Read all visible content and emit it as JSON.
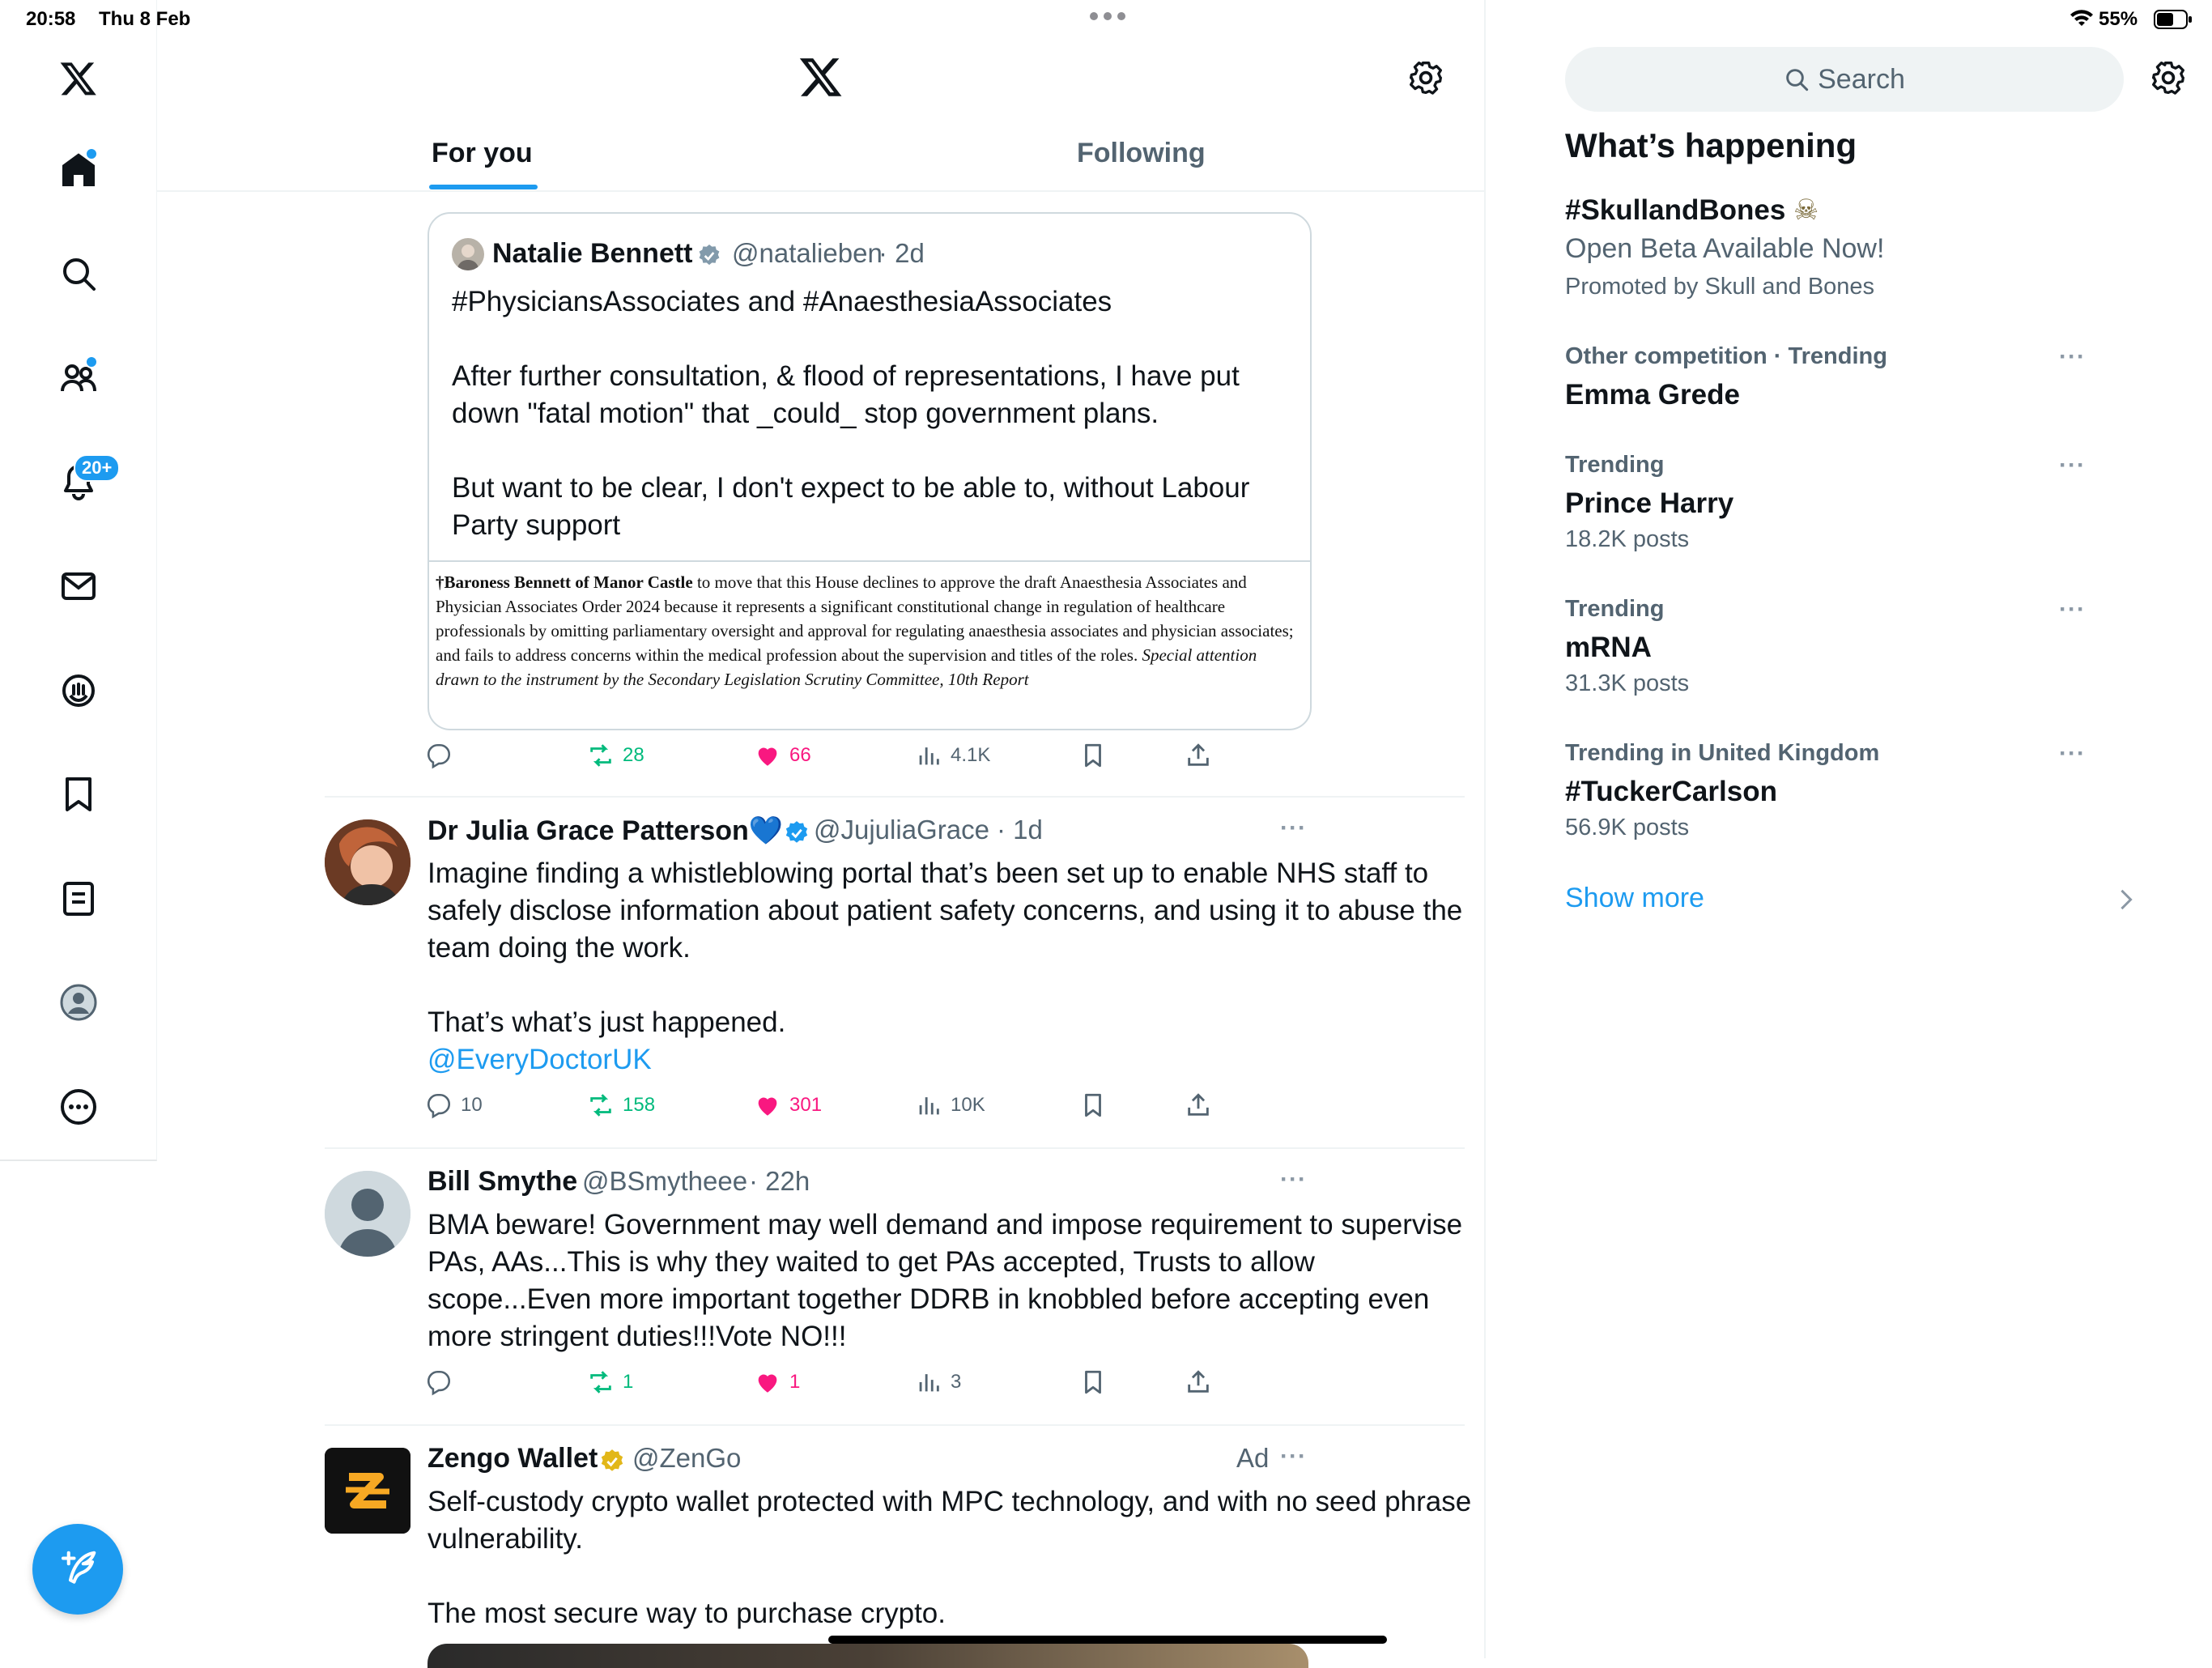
{
  "status_bar": {
    "time": "20:58",
    "date": "Thu 8 Feb",
    "battery": "55%"
  },
  "nav": {
    "notifications_badge": "20+",
    "items": [
      "home-icon",
      "search-icon",
      "communities-icon",
      "notifications-icon",
      "messages-icon",
      "grok-icon",
      "bookmarks-icon",
      "lists-icon",
      "profile-icon",
      "more-icon"
    ]
  },
  "header": {
    "tabs": [
      {
        "label": "For you",
        "active": true
      },
      {
        "label": "Following",
        "active": false
      }
    ]
  },
  "feed": {
    "quoted_tweet": {
      "name": "Natalie Bennett",
      "handle": "@natalieben",
      "time": "· 2d",
      "text": "#PhysiciansAssociates and #AnaesthesiaAssociates\n\nAfter further consultation, & flood of representations, I have put down \"fatal motion\" that _could_ stop government plans.\n\nBut want to be clear, I don't expect to be able to, without Labour Party support",
      "image_text_bold": "†Baroness Bennett of Manor Castle",
      "image_text": " to move that this House declines to approve the draft Anaesthesia Associates and Physician Associates Order 2024 because it represents a significant constitutional change in regulation of healthcare professionals by omitting parliamentary oversight and approval for regulating anaesthesia associates and physician associates; and fails to address concerns within the medical profession about the supervision and titles of the roles. ",
      "image_text_italic": "Special attention drawn to the instrument by the Secondary Legislation Scrutiny Committee, 10th Report",
      "actions": {
        "replies": "",
        "reposts": "28",
        "likes": "66",
        "views": "4.1K"
      }
    },
    "tweets": [
      {
        "name": "Dr Julia Grace Patterson💙",
        "handle": "@JujuliaGrace",
        "time": "· 1d",
        "text": "Imagine finding a whistleblowing portal that’s been set up to enable NHS staff to safely disclose information about patient safety concerns, and using it to abuse the team doing the work.\n\nThat’s what’s just happened.",
        "mention": "@EveryDoctorUK",
        "actions": {
          "replies": "10",
          "reposts": "158",
          "likes": "301",
          "views": "10K"
        }
      },
      {
        "name": "Bill Smythe",
        "handle": "@BSmytheee",
        "time": "· 22h",
        "text": "BMA beware! Government may well demand and impose requirement to supervise PAs, AAs...This is why they waited to get PAs accepted, Trusts to allow scope...Even more important together DDRB in knobbled before accepting even more stringent duties!!!Vote NO!!!",
        "actions": {
          "replies": "",
          "reposts": "1",
          "likes": "1",
          "views": "3"
        }
      },
      {
        "name": "Zengo Wallet",
        "handle": "@ZenGo",
        "ad_label": "Ad",
        "text": "Self-custody crypto wallet protected with MPC technology, and with no seed phrase vulnerability.\n\nThe most secure way to purchase crypto."
      }
    ]
  },
  "sidebar": {
    "search_placeholder": "Search",
    "section_title": "What’s happening",
    "promoted": {
      "title": "#SkullandBones",
      "emoji": "☠",
      "subtitle": "Open Beta Available Now!",
      "meta": "Promoted by Skull and Bones"
    },
    "trends": [
      {
        "meta": "Other competition · Trending",
        "title": "Emma Grede",
        "posts": ""
      },
      {
        "meta": "Trending",
        "title": "Prince Harry",
        "posts": "18.2K posts"
      },
      {
        "meta": "Trending",
        "title": "mRNA",
        "posts": "31.3K posts"
      },
      {
        "meta": "Trending in United Kingdom",
        "title": "#TuckerCarlson",
        "posts": "56.9K posts"
      }
    ],
    "show_more": "Show more"
  },
  "colors": {
    "accent": "#1d9bf0",
    "repost": "#00ba7c",
    "like": "#f91880",
    "muted": "#536471"
  }
}
